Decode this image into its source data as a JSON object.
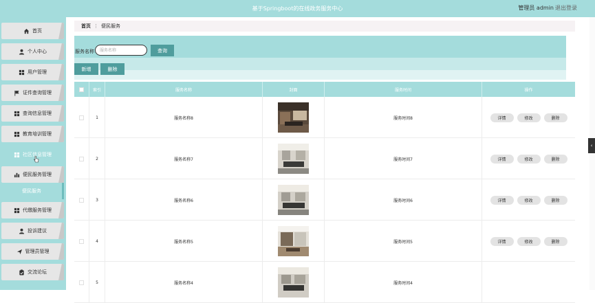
{
  "header": {
    "title": "基于Springboot的在线政务服务中心",
    "user_label": "管理员 admin",
    "logout_label": "退出登录"
  },
  "sidebar": {
    "items": [
      {
        "label": "首页",
        "icon": "home-icon"
      },
      {
        "label": "个人中心",
        "icon": "user-icon"
      },
      {
        "label": "用户管理",
        "icon": "grid-icon"
      },
      {
        "label": "证件查询管理",
        "icon": "flag-icon"
      },
      {
        "label": "查询信息管理",
        "icon": "grid-icon"
      },
      {
        "label": "教育培训管理",
        "icon": "grid-icon"
      },
      {
        "label": "社区信息管理",
        "icon": "grid-icon"
      },
      {
        "label": "便民服务管理",
        "icon": "bar-chart-icon"
      },
      {
        "label": "代缴服务管理",
        "icon": "grid-icon"
      },
      {
        "label": "投诉建议",
        "icon": "user-icon"
      },
      {
        "label": "管理员管理",
        "icon": "send-icon"
      },
      {
        "label": "交流论坛",
        "icon": "clipboard-icon"
      }
    ],
    "sub_item": "便民服务"
  },
  "breadcrumb": {
    "home": "首页",
    "separator": "⋮",
    "current": "便民服务"
  },
  "search": {
    "label": "服务名称",
    "placeholder": "服务名称",
    "query_button": "查询"
  },
  "actions": {
    "add": "新增",
    "delete": "删除"
  },
  "table": {
    "headers": {
      "index": "索引",
      "name": "服务名称",
      "cover": "封面",
      "time": "服务时间",
      "ops": "操作"
    },
    "op_labels": {
      "detail": "详情",
      "edit": "修改",
      "delete": "删除"
    },
    "rows": [
      {
        "index": "1",
        "name": "服务名称8",
        "time": "服务时间8"
      },
      {
        "index": "2",
        "name": "服务名称7",
        "time": "服务时间7"
      },
      {
        "index": "3",
        "name": "服务名称6",
        "time": "服务时间6"
      },
      {
        "index": "4",
        "name": "服务名称5",
        "time": "服务时间5"
      },
      {
        "index": "5",
        "name": "服务名称4",
        "time": "服务时间4"
      }
    ]
  },
  "colors": {
    "accent": "#a4dcdc",
    "button_dark": "#4f9d9d",
    "menu_bg": "#e6e6e6"
  }
}
